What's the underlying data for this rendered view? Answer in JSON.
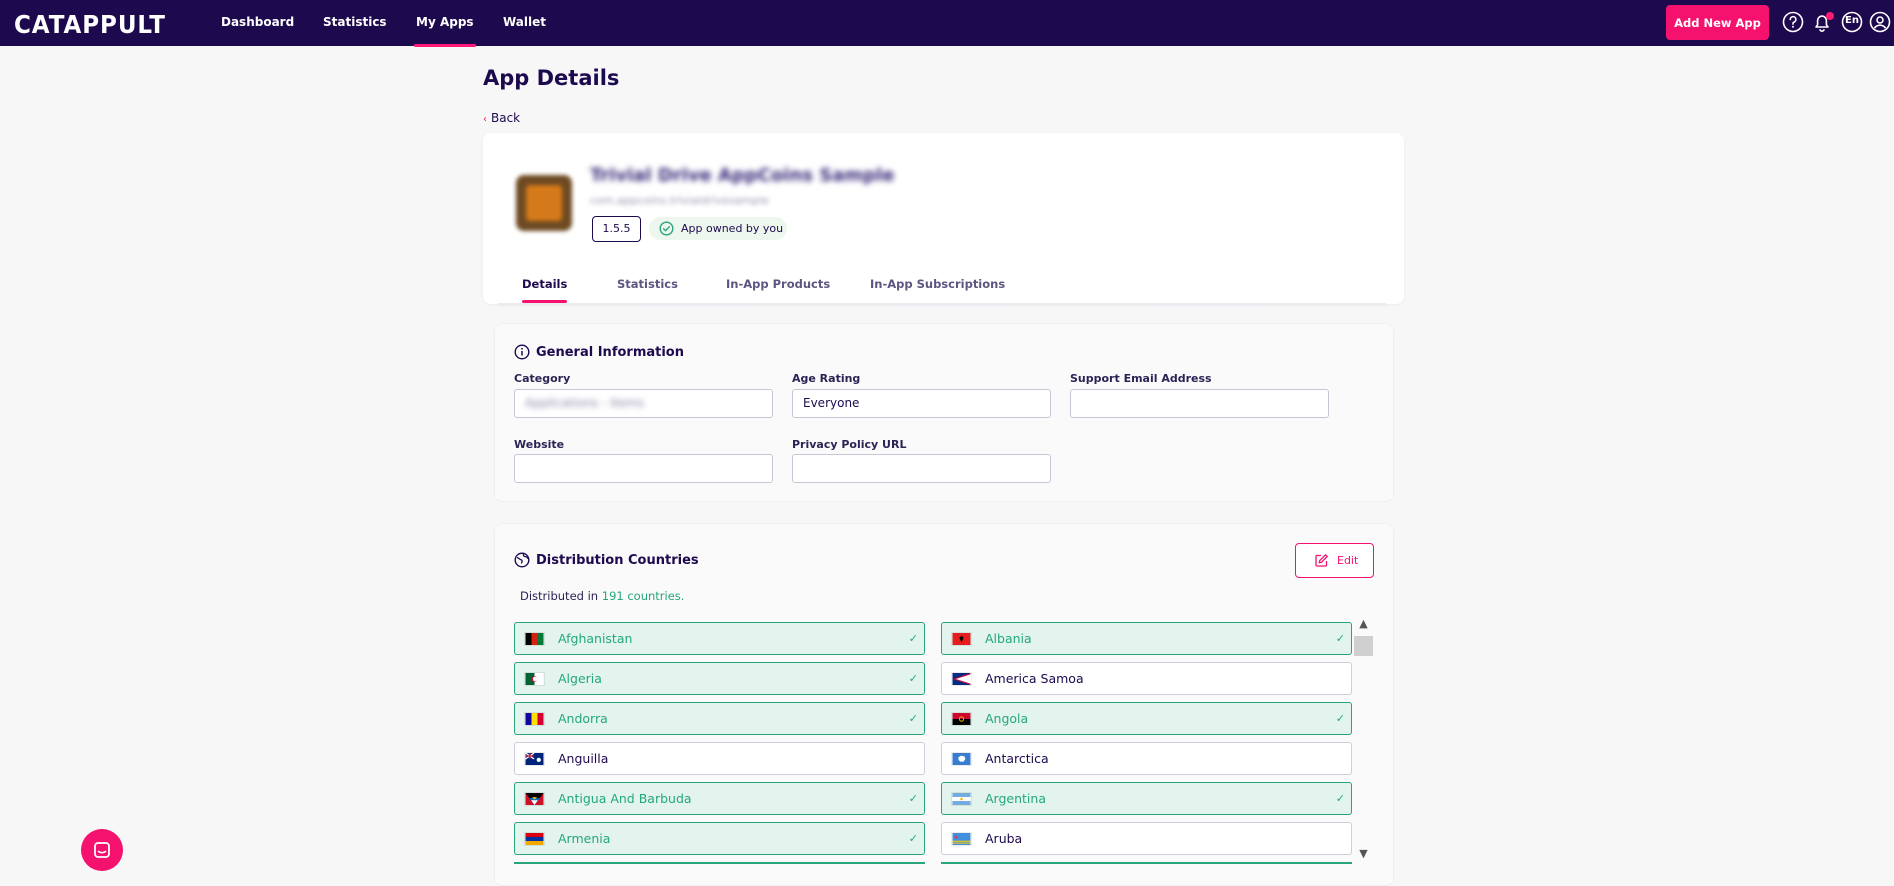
{
  "nav": {
    "logo": "CATAPPULT",
    "items": [
      {
        "label": "Dashboard"
      },
      {
        "label": "Statistics"
      },
      {
        "label": "My Apps"
      },
      {
        "label": "Wallet"
      }
    ],
    "add_app_label": "Add New App",
    "language": "En"
  },
  "page": {
    "title": "App Details",
    "back_label": "Back"
  },
  "app": {
    "name": "Trivial Drive AppCoins Sample",
    "package": "com.appcoins.trivialdrivesample",
    "version": "1.5.5",
    "owned_label": "App owned by you"
  },
  "tabs": [
    {
      "label": "Details"
    },
    {
      "label": "Statistics"
    },
    {
      "label": "In-App Products"
    },
    {
      "label": "In-App Subscriptions"
    }
  ],
  "general": {
    "title": "General Information",
    "category_label": "Category",
    "category_value": "Applications - Items",
    "age_label": "Age Rating",
    "age_value": "Everyone",
    "email_label": "Support Email Address",
    "email_value": "",
    "website_label": "Website",
    "website_value": "",
    "privacy_label": "Privacy Policy URL",
    "privacy_value": ""
  },
  "distribution": {
    "title": "Distribution Countries",
    "edit_label": "Edit",
    "summary_prefix": "Distributed in ",
    "summary_count": "191 countries.",
    "countries": [
      {
        "name": "Afghanistan",
        "selected": true
      },
      {
        "name": "Albania",
        "selected": true
      },
      {
        "name": "Algeria",
        "selected": true
      },
      {
        "name": "America Samoa",
        "selected": false
      },
      {
        "name": "Andorra",
        "selected": true
      },
      {
        "name": "Angola",
        "selected": true
      },
      {
        "name": "Anguilla",
        "selected": false
      },
      {
        "name": "Antarctica",
        "selected": false
      },
      {
        "name": "Antigua And Barbuda",
        "selected": true
      },
      {
        "name": "Argentina",
        "selected": true
      },
      {
        "name": "Armenia",
        "selected": true
      },
      {
        "name": "Aruba",
        "selected": false
      }
    ]
  },
  "colors": {
    "nav_bg": "#1d0a4e",
    "accent": "#f5116e",
    "selected_bg": "#e3f3ee",
    "selected_text": "#24a878"
  }
}
